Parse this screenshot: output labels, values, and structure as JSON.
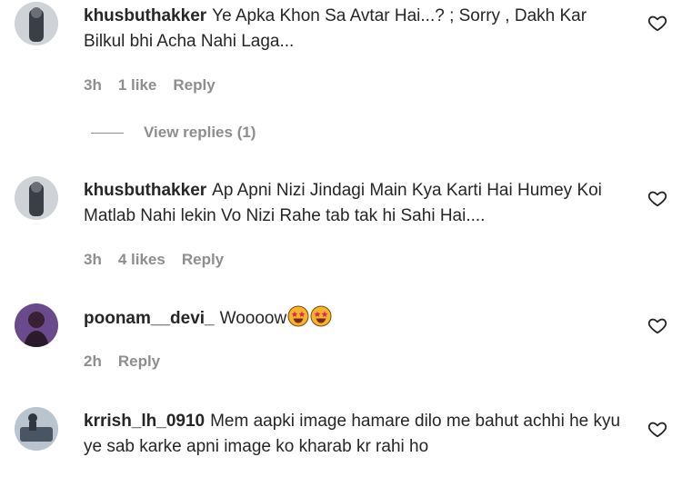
{
  "comments": [
    {
      "username": "khusbuthakker",
      "text": "Ye Apka Khon Sa Avtar Hai...? ; Sorry , Dakh Kar Bilkul bhi Acha Nahi Laga...",
      "time": "3h",
      "likes": "1 like",
      "reply_label": "Reply",
      "view_replies": "View replies (1)"
    },
    {
      "username": "khusbuthakker",
      "text": "Ap Apni Nizi Jindagi Main Kya Karti Hai Humey Koi Matlab Nahi lekin Vo Nizi Rahe tab tak hi Sahi Hai....",
      "time": "3h",
      "likes": "4 likes",
      "reply_label": "Reply"
    },
    {
      "username": "poonam__devi_",
      "text": "Woooow",
      "emojis": [
        "star-struck-emoji",
        "star-struck-emoji"
      ],
      "time": "2h",
      "reply_label": "Reply"
    },
    {
      "username": "krrish_lh_0910",
      "text": "Mem aapki image hamare dilo me bahut achhi he kyu ye sab karke apni image ko kharab kr rahi ho"
    }
  ],
  "icons": {
    "like": "heart-outline-icon"
  },
  "colors": {
    "text": "#262626",
    "muted": "#8e8e8e",
    "emoji": "#f5b42a",
    "emoji_eyes": "#e0245e"
  }
}
